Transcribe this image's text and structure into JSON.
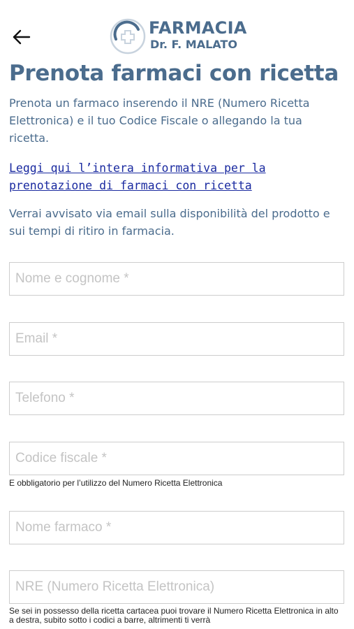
{
  "header": {
    "back_icon": "arrow-left-icon",
    "logo": {
      "name": "FARMACIA",
      "subtitle": "Dr. F. MALATO",
      "icon": "pharmacy-cross-logo"
    }
  },
  "page": {
    "title": "Prenota farmaci con ricetta",
    "intro": "Prenota un farmaco inserendo il NRE (Numero Ricetta Elettronica) e il tuo Codice Fiscale o allegando la tua ricetta.",
    "info_link": "Leggi qui l’intera informativa per la prenotazione di farmaci con ricetta",
    "notice": "Verrai avvisato via email sulla disponibilità del prodotto e sui tempi di ritiro in farmacia."
  },
  "form": {
    "name_placeholder": "Nome e cognome *",
    "email_placeholder": "Email *",
    "phone_placeholder": "Telefono *",
    "fiscal_code_placeholder": "Codice fiscale *",
    "fiscal_code_help": "E obbligatorio per l’utilizzo del Numero Ricetta Elettronica",
    "drug_placeholder": "Nome farmaco *",
    "nre_placeholder": "NRE (Numero Ricetta Elettronica)",
    "nre_help": "Se sei in possesso della ricetta cartacea puoi trovare il Numero Ricetta Elettronica in alto a destra, subito sotto i codici a barre, altrimenti ti verrà"
  },
  "colors": {
    "brand": "#4b6c8d",
    "link": "#1a2aa0",
    "border": "#cdcdcd",
    "placeholder": "#c4c4c4"
  }
}
